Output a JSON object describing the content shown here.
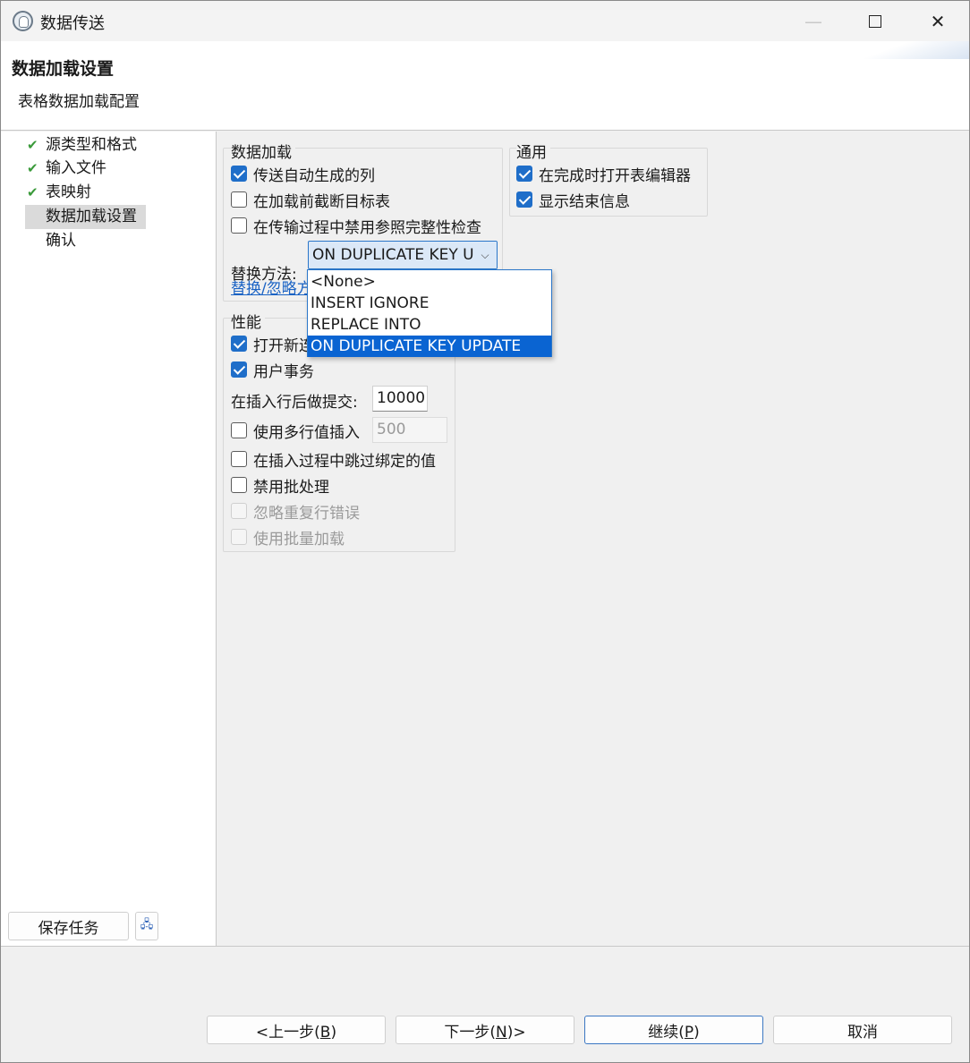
{
  "window": {
    "title": "数据传送",
    "minimize_icon": "minimize-icon",
    "maximize_icon": "maximize-icon",
    "close_icon": "close-icon",
    "close_glyph": "✕",
    "minimize_glyph": "—"
  },
  "header": {
    "title": "数据加载设置",
    "subtitle": "表格数据加载配置"
  },
  "nav": {
    "items": [
      {
        "label": "源类型和格式",
        "done": true
      },
      {
        "label": "输入文件",
        "done": true
      },
      {
        "label": "表映射",
        "done": true
      },
      {
        "label": "数据加载设置",
        "done": false,
        "selected": true
      },
      {
        "label": "确认",
        "done": false
      }
    ],
    "check_glyph": "✔",
    "save_task_label": "保存任务",
    "save_task_icon_glyph": "🖧"
  },
  "data_load": {
    "group_title": "数据加载",
    "options": [
      {
        "label": "传送自动生成的列",
        "checked": true
      },
      {
        "label": "在加载前截断目标表",
        "checked": false
      },
      {
        "label": "在传输过程中禁用参照完整性检查",
        "checked": false
      }
    ],
    "replace_method_label": "替换方法:",
    "replace_method_value": "ON DUPLICATE KEY UPDATE",
    "combo_arrow_glyph": "⌵",
    "link_text": "替换/忽略方法的说明"
  },
  "dropdown": {
    "options": [
      "<None>",
      "INSERT IGNORE",
      "REPLACE INTO",
      "ON DUPLICATE KEY UPDATE"
    ],
    "selected_index": 3
  },
  "general": {
    "group_title": "通用",
    "options": [
      {
        "label": "在完成时打开表编辑器",
        "checked": true
      },
      {
        "label": "显示结束信息",
        "checked": true
      }
    ]
  },
  "performance": {
    "group_title": "性能",
    "open_new_connection_label": "打开新连接",
    "user_transaction_label": "用户事务",
    "commit_after_label": "在插入行后做提交:",
    "commit_after_value": "10000",
    "multi_row_label": "使用多行值插入",
    "multi_row_value": "500",
    "skip_bind_label": "在插入过程中跳过绑定的值",
    "disable_batch_label": "禁用批处理",
    "ignore_dup_label": "忽略重复行错误",
    "bulk_load_label": "使用批量加载"
  },
  "footer": {
    "back_label": "<上一步(",
    "back_key": "B",
    "next_label": "下一步(",
    "next_key": "N",
    "next_suffix": ")>",
    "continue_label": "继续(",
    "continue_key": "P",
    "close_paren": ")",
    "cancel_label": "取消"
  }
}
